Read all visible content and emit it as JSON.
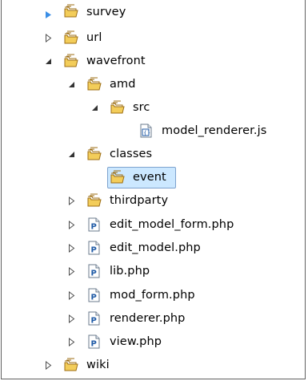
{
  "colors": {
    "folder": "#e6b93a",
    "folder_dark": "#9c6d13",
    "php_icon_blue": "#1f5aa6",
    "selection_bg": "#cce8ff",
    "selection_border": "#7da2ce",
    "twisty": "#4d4d4d"
  },
  "tree": [
    {
      "label": "survey",
      "icon": "folder-icon",
      "expanded": false,
      "depth": 0
    },
    {
      "label": "url",
      "icon": "folder-icon",
      "expanded": false,
      "depth": 0
    },
    {
      "label": "wavefront",
      "icon": "folder-icon",
      "expanded": true,
      "depth": 0
    },
    {
      "label": "amd",
      "icon": "folder-icon",
      "expanded": true,
      "depth": 1
    },
    {
      "label": "src",
      "icon": "folder-icon",
      "expanded": true,
      "depth": 2
    },
    {
      "label": "model_renderer.js",
      "icon": "js-file-icon",
      "depth": 3
    },
    {
      "label": "classes",
      "icon": "folder-icon",
      "expanded": true,
      "depth": 1
    },
    {
      "label": "event",
      "icon": "folder-icon",
      "selected": true,
      "depth": 2
    },
    {
      "label": "thirdparty",
      "icon": "folder-icon",
      "expanded": false,
      "depth": 1
    },
    {
      "label": "edit_model_form.php",
      "icon": "php-file-icon",
      "expanded": false,
      "depth": 1
    },
    {
      "label": "edit_model.php",
      "icon": "php-file-icon",
      "expanded": false,
      "depth": 1
    },
    {
      "label": "lib.php",
      "icon": "php-file-icon",
      "expanded": false,
      "depth": 1
    },
    {
      "label": "mod_form.php",
      "icon": "php-file-icon",
      "expanded": false,
      "depth": 1
    },
    {
      "label": "renderer.php",
      "icon": "php-file-icon",
      "expanded": false,
      "depth": 1
    },
    {
      "label": "view.php",
      "icon": "php-file-icon",
      "expanded": false,
      "depth": 1
    },
    {
      "label": "wiki",
      "icon": "folder-icon",
      "expanded": false,
      "depth": 0
    }
  ]
}
